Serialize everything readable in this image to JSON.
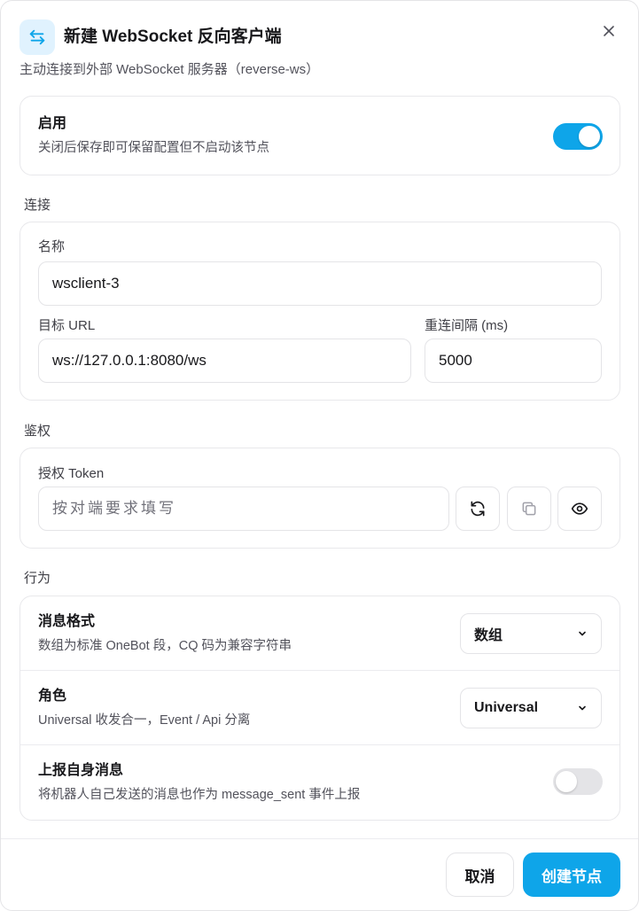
{
  "dialog": {
    "title": "新建 WebSocket 反向客户端",
    "subtitle": "主动连接到外部 WebSocket 服务器（reverse-ws）",
    "header_icon": "swap-arrows-icon",
    "close_icon": "close-icon"
  },
  "enable": {
    "title": "启用",
    "description": "关闭后保存即可保留配置但不启动该节点",
    "checked": true
  },
  "connection": {
    "section_label": "连接",
    "name_label": "名称",
    "name_value": "wsclient-3",
    "url_label": "目标 URL",
    "url_value": "ws://127.0.0.1:8080/ws",
    "reconnect_label": "重连间隔 (ms)",
    "reconnect_value": "5000"
  },
  "auth": {
    "section_label": "鉴权",
    "token_label": "授权 Token",
    "token_placeholder": "按对端要求填写",
    "token_value": "",
    "buttons": [
      "refresh-icon",
      "copy-icon",
      "eye-icon"
    ]
  },
  "behavior": {
    "section_label": "行为",
    "message_format": {
      "title": "消息格式",
      "description": "数组为标准 OneBot 段，CQ 码为兼容字符串",
      "selected": "数组"
    },
    "role": {
      "title": "角色",
      "description": "Universal 收发合一，Event / Api 分离",
      "selected": "Universal"
    },
    "report_self": {
      "title": "上报自身消息",
      "description": "将机器人自己发送的消息也作为 message_sent 事件上报",
      "checked": false
    }
  },
  "footer": {
    "cancel_label": "取消",
    "create_label": "创建节点"
  },
  "colors": {
    "accent": "#0ea5e9",
    "icon_bg": "#e0f2fe",
    "border": "#e4e4e7"
  }
}
